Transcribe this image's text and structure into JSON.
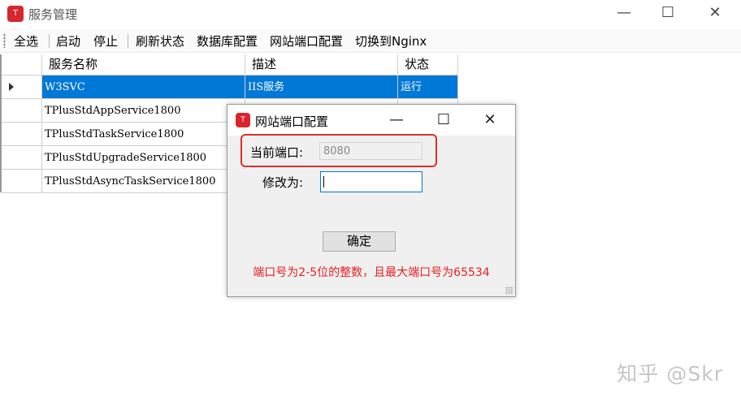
{
  "window": {
    "title": "服务管理",
    "icon": "app-logo-icon",
    "controls": {
      "minimize": "—",
      "maximize": "☐",
      "close": "✕"
    }
  },
  "toolbar": {
    "items": [
      "全选",
      "启动",
      "停止",
      "刷新状态",
      "数据库配置",
      "网站端口配置",
      "切换到Nginx"
    ]
  },
  "grid": {
    "columns": [
      "服务名称",
      "描述",
      "状态"
    ],
    "rows": [
      {
        "name": "W3SVC",
        "desc": "IIS服务",
        "status": "运行",
        "selected": true
      },
      {
        "name": "TPlusStdAppService1800",
        "desc": "",
        "status": ""
      },
      {
        "name": "TPlusStdTaskService1800",
        "desc": "",
        "status": ""
      },
      {
        "name": "TPlusStdUpgradeService1800",
        "desc": "",
        "status": ""
      },
      {
        "name": "TPlusStdAsyncTaskService1800",
        "desc": "",
        "status": ""
      }
    ]
  },
  "dialog": {
    "title": "网站端口配置",
    "controls": {
      "minimize": "—",
      "maximize": "☐",
      "close": "✕"
    },
    "current_port_label": "当前端口:",
    "current_port_value": "8080",
    "new_port_label": "修改为:",
    "new_port_value": "",
    "ok_label": "确定",
    "hint": "端口号为2-5位的整数，且最大端口号为65534",
    "highlight_color": "#e02e2a",
    "hint_color": "#e62020"
  },
  "selection_color": "#0078d7",
  "watermark": "知乎 @Skr"
}
